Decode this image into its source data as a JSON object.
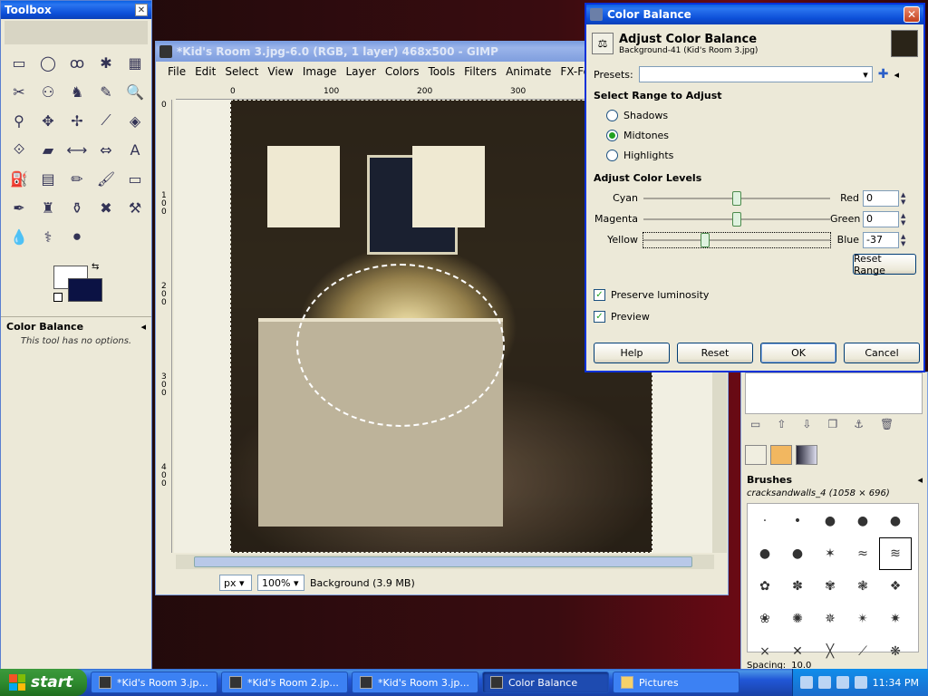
{
  "toolbox": {
    "title": "Toolbox",
    "close": "✕",
    "tools": [
      "▭",
      "◯",
      "ꝏ",
      "✱",
      "▦",
      "✂",
      "⚇",
      "♞",
      "✎",
      "🔍",
      "⚲",
      "✥",
      "✢",
      "⟋",
      "◈",
      "⟐",
      "▰",
      "⟷",
      "⇔",
      "A",
      "⛽",
      "▤",
      "✏",
      "🖌",
      "▭",
      "✒",
      "♜",
      "⚱",
      "✖",
      "⚒",
      "💧",
      "⚕",
      "⚫"
    ],
    "options_title": "Color Balance",
    "options_note": "This tool has no options."
  },
  "image_window": {
    "title": "*Kid's Room 3.jpg-6.0 (RGB, 1 layer) 468x500 - GIMP",
    "menu": [
      "File",
      "Edit",
      "Select",
      "View",
      "Image",
      "Layer",
      "Colors",
      "Tools",
      "Filters",
      "Animate",
      "FX-Foundry"
    ],
    "ruler_h": [
      "0",
      "100",
      "200",
      "300"
    ],
    "ruler_v": [
      "0",
      "1 0 0",
      "2 0 0",
      "3 0 0",
      "4 0 0"
    ],
    "unit": "px",
    "zoom": "100%",
    "status": "Background (3.9 MB)"
  },
  "color_balance": {
    "title": "Color Balance",
    "heading": "Adjust Color Balance",
    "subheading": "Background-41 (Kid's Room 3.jpg)",
    "presets_label": "Presets:",
    "presets_value": "",
    "range_section": "Select Range to Adjust",
    "ranges": [
      "Shadows",
      "Midtones",
      "Highlights"
    ],
    "selected_range": "Midtones",
    "levels_section": "Adjust Color Levels",
    "sliders": [
      {
        "left": "Cyan",
        "right": "Red",
        "value": "0",
        "level": 0.5
      },
      {
        "left": "Magenta",
        "right": "Green",
        "value": "0",
        "level": 0.5
      },
      {
        "left": "Yellow",
        "right": "Blue",
        "value": "-37",
        "level": 0.32
      }
    ],
    "reset_range": "Reset Range",
    "preserve_luminosity": "Preserve luminosity",
    "preview": "Preview",
    "buttons": {
      "help": "Help",
      "reset": "Reset",
      "ok": "OK",
      "cancel": "Cancel"
    }
  },
  "dock": {
    "brushes_title": "Brushes",
    "brush_name": "cracksandwalls_4 (1058 × 696)",
    "brushes": [
      "·",
      "•",
      "●",
      "●",
      "●",
      "●",
      "●",
      "✶",
      "≈",
      "≋",
      "✿",
      "✽",
      "✾",
      "❃",
      "❖",
      "❀",
      "✺",
      "✵",
      "✴",
      "✷",
      "×",
      "✕",
      "╳",
      "⟋",
      "❋"
    ],
    "spacing_label": "Spacing:",
    "spacing_value": "10.0"
  },
  "taskbar": {
    "start": "start",
    "tasks": [
      "*Kid's Room 3.jp...",
      "*Kid's Room 2.jp...",
      "*Kid's Room 3.jp...",
      "Color Balance",
      "Pictures"
    ],
    "active_task": "Color Balance",
    "clock": "11:34 PM"
  },
  "colors": {
    "xp_blue": "#0a5fe3",
    "fg_color": "#ffffff",
    "bg_color": "#0b1244"
  }
}
